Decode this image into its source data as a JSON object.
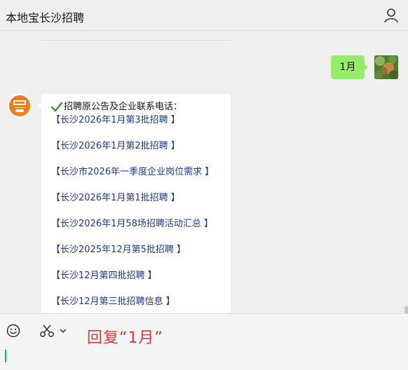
{
  "header": {
    "title": "本地宝长沙招聘",
    "user_icon": "user-icon"
  },
  "chat": {
    "sent": {
      "text": "1月"
    },
    "received": {
      "headline": "招聘原公告及企业联系电话：",
      "links": [
        "【长沙2026年1月第3批招聘 】",
        "【长沙2026年1月第2批招聘 】",
        "【长沙市2026年一季度企业岗位需求 】",
        "【长沙2026年1月第1批招聘 】",
        "【长沙2026年1月58场招聘活动汇总 】",
        "【长沙2025年12月第5批招聘 】",
        "【长沙12月第四批招聘 】",
        "【长沙12月第三批招聘信息 】"
      ]
    }
  },
  "toolbar": {
    "emoji_icon": "emoji-icon",
    "scissors_icon": "scissors-icon",
    "chevron_icon": "chevron-down-icon"
  },
  "reply_hint": "回复“1月”",
  "colors": {
    "my_bubble": "#95ec69",
    "link": "#1f3a8a",
    "hint": "#e03a3a",
    "caret": "#07c160"
  }
}
